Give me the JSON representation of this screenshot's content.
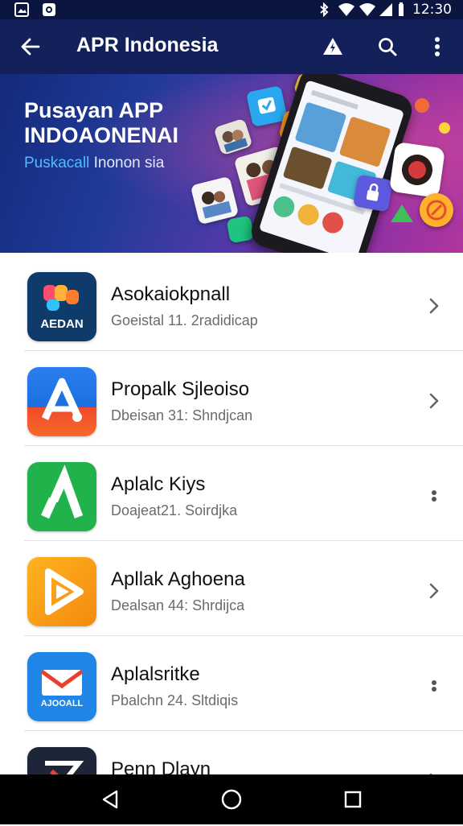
{
  "status_bar": {
    "time": "12:30",
    "left_icons": [
      "gallery-icon",
      "message-icon"
    ],
    "right_icons": [
      "bluetooth-icon",
      "wifi-icon",
      "signal-icon",
      "battery-icon"
    ]
  },
  "app_bar": {
    "title": "APR Indonesia",
    "actions": [
      "back-arrow-icon",
      "warning-icon",
      "search-icon",
      "more-vert-icon"
    ]
  },
  "banner": {
    "headline": "Pusayan APP INDOAONENAI",
    "subtitle_accent": "Puskacall",
    "subtitle_rest": " Inonon sia"
  },
  "apps": [
    {
      "name": "Asokaiokpnall",
      "subtitle": "Goeistal 11. 2radidicap",
      "icon": "aedan-app-icon",
      "icon_text": "AEDAN",
      "color": "#0f3b6b",
      "action": "chevron-right-icon"
    },
    {
      "name": "Propalk Sjleoiso",
      "subtitle": "Dbeisan 31: Shndjcan",
      "icon": "a-logo-app-icon",
      "color": "#1d6fe0",
      "action": "chevron-right-icon"
    },
    {
      "name": "Aplalc Kiys",
      "subtitle": "Doajeat21. Soirdjka",
      "icon": "green-a-app-icon",
      "color": "#21b24b",
      "action": "drag-handle-icon"
    },
    {
      "name": "Apllak Aghoena",
      "subtitle": "Dealsan 44: Shrdijca",
      "icon": "play-app-icon",
      "color": "#f59a12",
      "action": "chevron-right-icon"
    },
    {
      "name": "Aplalsritke",
      "subtitle": "Pbalchn 24. Sltdiqis",
      "icon": "mail-app-icon",
      "icon_text": "AJOOALL",
      "color": "#1f86e8",
      "action": "drag-handle-icon"
    },
    {
      "name": "Penn Dlayn",
      "subtitle": "",
      "icon": "dark-app-icon",
      "color": "#1c2638",
      "action": "chevron-right-icon"
    }
  ],
  "nav_bar": [
    "back-nav-icon",
    "home-nav-icon",
    "recents-nav-icon"
  ]
}
